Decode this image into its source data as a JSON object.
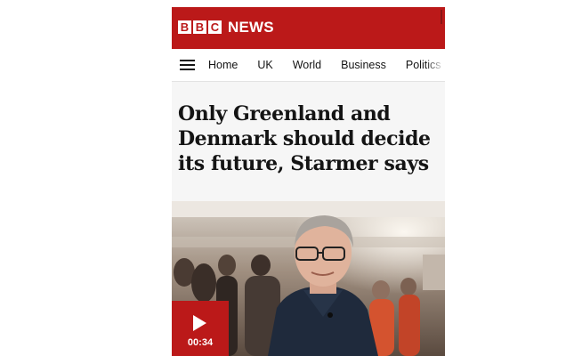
{
  "header": {
    "logo_letters": [
      "B",
      "B",
      "C"
    ],
    "section_name": "NEWS",
    "brand_color": "#bb1919"
  },
  "nav": {
    "menu_icon": "hamburger-menu-icon",
    "items": [
      {
        "label": "Home"
      },
      {
        "label": "UK"
      },
      {
        "label": "World"
      },
      {
        "label": "Business"
      },
      {
        "label": "Politics"
      }
    ]
  },
  "article": {
    "headline": "Only Greenland and Denmark should decide its future, Starmer says"
  },
  "video": {
    "play_icon": "play-icon",
    "duration": "00:34"
  }
}
